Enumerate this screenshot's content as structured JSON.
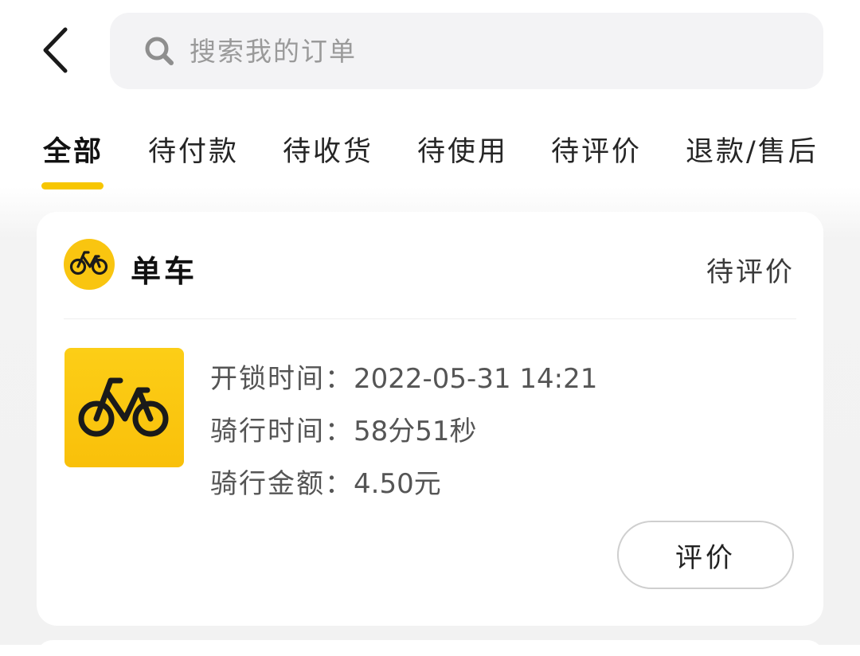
{
  "header": {
    "back_icon": "chevron-left-icon",
    "search": {
      "icon": "search-icon",
      "placeholder": "搜索我的订单",
      "value": ""
    }
  },
  "tabs": [
    {
      "label": "全部",
      "active": true
    },
    {
      "label": "待付款",
      "active": false
    },
    {
      "label": "待收货",
      "active": false
    },
    {
      "label": "待使用",
      "active": false
    },
    {
      "label": "待评价",
      "active": false
    },
    {
      "label": "退款/售后",
      "active": false
    }
  ],
  "colors": {
    "accent": "#f7c600",
    "logo_bg": "#f9c510",
    "text_secondary": "#555555"
  },
  "order": {
    "service_icon": "bicycle-icon",
    "service_name": "单车",
    "status": "待评价",
    "details": [
      {
        "label": "开锁时间：",
        "value": "2022-05-31 14:21"
      },
      {
        "label": "骑行时间：",
        "value": "58分51秒"
      },
      {
        "label": "骑行金额：",
        "value": "4.50元"
      }
    ],
    "action_label": "评价"
  }
}
